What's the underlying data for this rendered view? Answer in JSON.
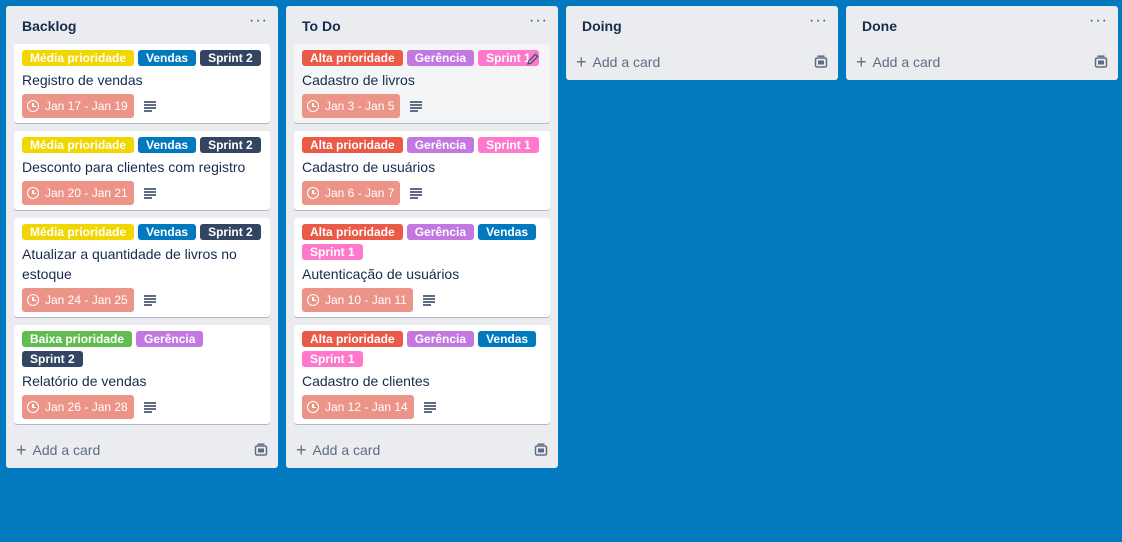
{
  "lists": [
    {
      "title": "Backlog",
      "menu": "···",
      "add_card": "Add a card",
      "cards": [
        {
          "labels": [
            {
              "text": "Média prioridade",
              "color": "yellow"
            },
            {
              "text": "Vendas",
              "color": "blue"
            },
            {
              "text": "Sprint 2",
              "color": "navy"
            }
          ],
          "title": "Registro de vendas",
          "due": "Jan 17 - Jan 19"
        },
        {
          "labels": [
            {
              "text": "Média prioridade",
              "color": "yellow"
            },
            {
              "text": "Vendas",
              "color": "blue"
            },
            {
              "text": "Sprint 2",
              "color": "navy"
            }
          ],
          "title": "Desconto para clientes com registro",
          "due": "Jan 20 - Jan 21"
        },
        {
          "labels": [
            {
              "text": "Média prioridade",
              "color": "yellow"
            },
            {
              "text": "Vendas",
              "color": "blue"
            },
            {
              "text": "Sprint 2",
              "color": "navy"
            }
          ],
          "title": "Atualizar a quantidade de livros no estoque",
          "due": "Jan 24 - Jan 25"
        },
        {
          "labels": [
            {
              "text": "Baixa prioridade",
              "color": "green"
            },
            {
              "text": "Gerência",
              "color": "purple"
            },
            {
              "text": "Sprint 2",
              "color": "navy"
            }
          ],
          "title": "Relatório de vendas",
          "due": "Jan 26 - Jan 28"
        }
      ]
    },
    {
      "title": "To Do",
      "menu": "···",
      "add_card": "Add a card",
      "cards": [
        {
          "labels": [
            {
              "text": "Alta prioridade",
              "color": "red"
            },
            {
              "text": "Gerência",
              "color": "purple"
            },
            {
              "text": "Sprint 1",
              "color": "pink"
            }
          ],
          "title": "Cadastro de livros",
          "due": "Jan 3 - Jan 5",
          "hover": true
        },
        {
          "labels": [
            {
              "text": "Alta prioridade",
              "color": "red"
            },
            {
              "text": "Gerência",
              "color": "purple"
            },
            {
              "text": "Sprint 1",
              "color": "pink"
            }
          ],
          "title": "Cadastro de usuários",
          "due": "Jan 6 - Jan 7"
        },
        {
          "labels": [
            {
              "text": "Alta prioridade",
              "color": "red"
            },
            {
              "text": "Gerência",
              "color": "purple"
            },
            {
              "text": "Vendas",
              "color": "blue"
            },
            {
              "text": "Sprint 1",
              "color": "pink"
            }
          ],
          "title": "Autenticação de usuários",
          "due": "Jan 10 - Jan 11"
        },
        {
          "labels": [
            {
              "text": "Alta prioridade",
              "color": "red"
            },
            {
              "text": "Gerência",
              "color": "purple"
            },
            {
              "text": "Vendas",
              "color": "blue"
            },
            {
              "text": "Sprint 1",
              "color": "pink"
            }
          ],
          "title": "Cadastro de clientes",
          "due": "Jan 12 - Jan 14"
        }
      ]
    },
    {
      "title": "Doing",
      "menu": "···",
      "add_card": "Add a card",
      "cards": []
    },
    {
      "title": "Done",
      "menu": "···",
      "add_card": "Add a card",
      "cards": []
    }
  ],
  "colors": {
    "board_bg": "#0079bf",
    "list_bg": "#ebecf0",
    "due_bg": "#ec9488"
  }
}
